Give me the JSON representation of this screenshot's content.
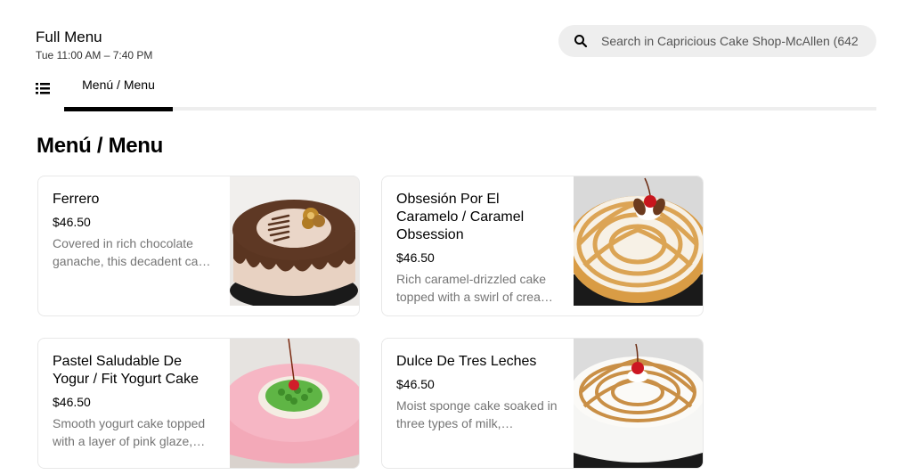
{
  "header": {
    "title": "Full Menu",
    "hours": "Tue 11:00 AM – 7:40 PM"
  },
  "search": {
    "placeholder": "Search in Capricious Cake Shop-McAllen (642"
  },
  "tabs": [
    {
      "label": "Menú / Menu",
      "active": true
    }
  ],
  "section": {
    "title": "Menú / Menu"
  },
  "items": [
    {
      "name": "Ferrero",
      "price": "$46.50",
      "description": "Covered in rich chocolate ganache, this decadent cake is topped with Ferrero candies.",
      "image_icon": "chocolate-cake-image"
    },
    {
      "name": "Obsesión Por El Caramelo / Caramel Obsession",
      "price": "$46.50",
      "description": "Rich caramel-drizzled cake topped with a swirl of cream and pecans.",
      "image_icon": "caramel-cake-image"
    },
    {
      "name": "Pastel Saludable De Yogur / Fit Yogurt Cake",
      "price": "$46.50",
      "description": "Smooth yogurt cake topped with a layer of pink glaze, kiwi and whipped cream.",
      "image_icon": "yogurt-cake-image"
    },
    {
      "name": "Dulce De Tres Leches",
      "price": "$46.50",
      "description": "Moist sponge cake soaked in three types of milk, decorated with caramel.",
      "image_icon": "tres-leches-cake-image"
    }
  ],
  "colors": {
    "accent": "#000000",
    "search_bg": "#eeeeee",
    "muted_text": "#757575"
  }
}
